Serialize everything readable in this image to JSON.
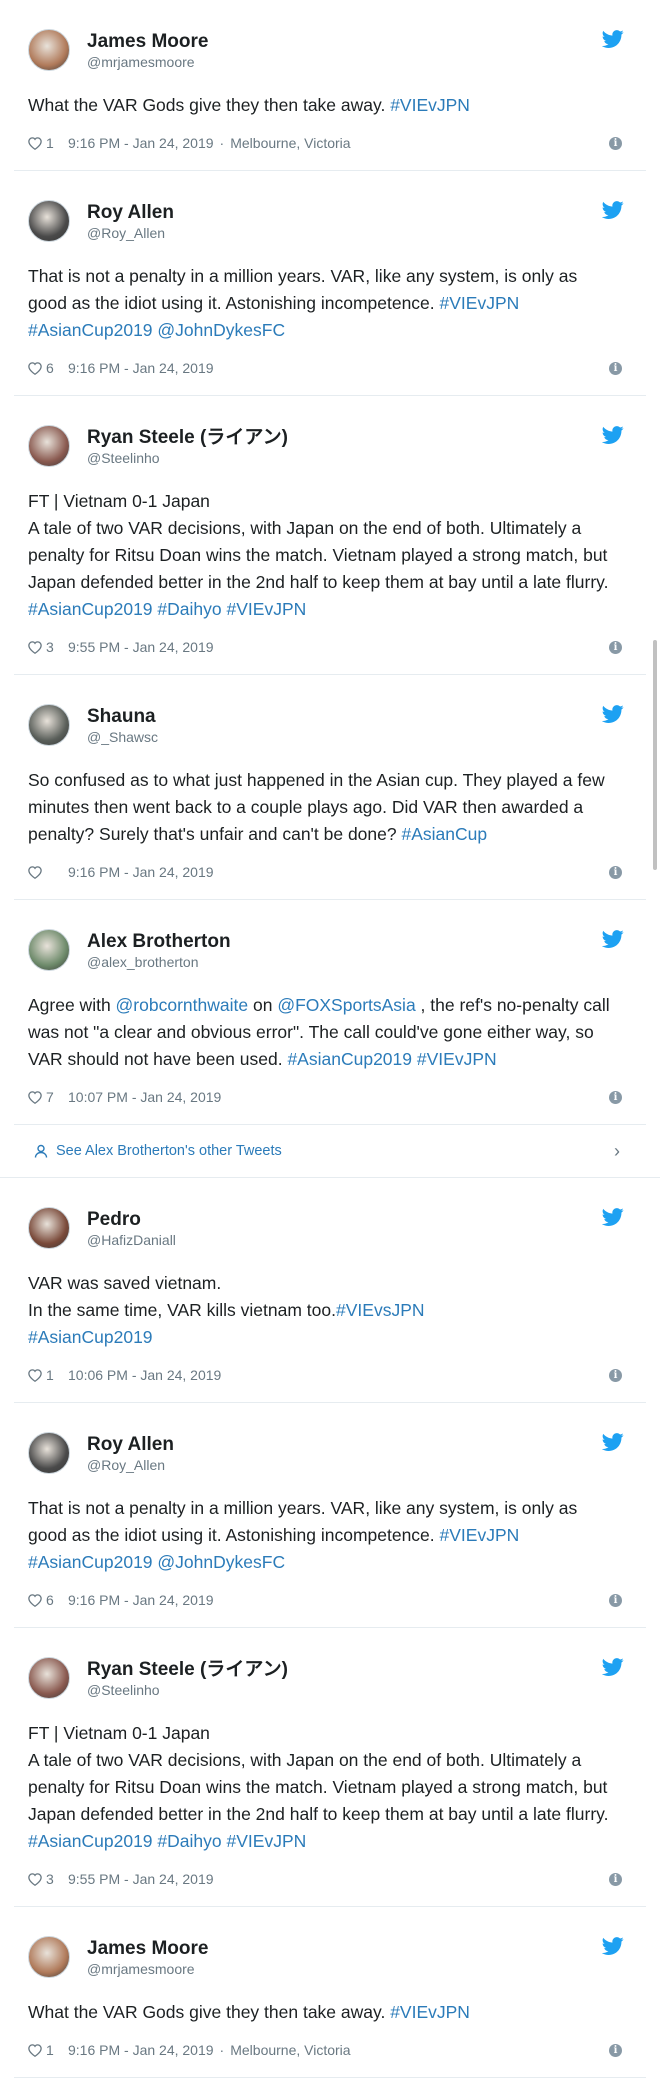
{
  "colors": {
    "link": "#2b7bb9",
    "meta": "#697882",
    "bird": "#1da1f2"
  },
  "see_more": {
    "label": "See Alex Brotherton's other Tweets"
  },
  "tweets": [
    {
      "name": "James Moore",
      "handle": "@mrjamesmoore",
      "avatar_color": "#b07a5a",
      "segments": [
        {
          "t": "What the VAR Gods give they then take away.  "
        },
        {
          "t": "#VIEvJPN",
          "link": true
        }
      ],
      "likes": "1",
      "time": "9:16 PM - Jan 24, 2019",
      "location": "Melbourne, Victoria"
    },
    {
      "name": "Roy Allen",
      "handle": "@Roy_Allen",
      "avatar_color": "#4a4a4a",
      "segments": [
        {
          "t": "That is not a penalty in a million years. VAR, like any system, is only as good as the idiot using it.  Astonishing incompetence. "
        },
        {
          "t": "#VIEvJPN",
          "link": true
        },
        {
          "t": " "
        },
        {
          "t": "#AsianCup2019",
          "link": true
        },
        {
          "t": " "
        },
        {
          "t": "@JohnDykesFC",
          "link": true
        }
      ],
      "likes": "6",
      "time": "9:16 PM - Jan 24, 2019",
      "location": ""
    },
    {
      "name": "Ryan Steele (ライアン)",
      "handle": "@Steelinho",
      "avatar_color": "#8a5a50",
      "segments": [
        {
          "t": "FT | Vietnam 0-1 Japan\nA tale of two VAR decisions, with Japan on the end of both. Ultimately a penalty for Ritsu Doan wins the match. Vietnam played a strong match, but Japan defended better in the 2nd half to keep them at bay until a late flurry. "
        },
        {
          "t": "#AsianCup2019",
          "link": true
        },
        {
          "t": " "
        },
        {
          "t": "#Daihyo",
          "link": true
        },
        {
          "t": " "
        },
        {
          "t": "#VIEvJPN",
          "link": true
        }
      ],
      "likes": "3",
      "time": "9:55 PM - Jan 24, 2019",
      "location": ""
    },
    {
      "name": "Shauna",
      "handle": "@_Shawsc",
      "avatar_color": "#5a5f5a",
      "segments": [
        {
          "t": "So confused as to what just happened in the Asian cup. They played a few minutes then went back to a couple plays ago. Did VAR then awarded a penalty? Surely that's unfair and can't be done? "
        },
        {
          "t": "#AsianCup",
          "link": true
        }
      ],
      "likes": "",
      "time": "9:16 PM - Jan 24, 2019",
      "location": ""
    },
    {
      "name": "Alex Brotherton",
      "handle": "@alex_brotherton",
      "avatar_color": "#6d8a6a",
      "segments": [
        {
          "t": "Agree with "
        },
        {
          "t": "@robcornthwaite",
          "link": true
        },
        {
          "t": " on "
        },
        {
          "t": "@FOXSportsAsia",
          "link": true
        },
        {
          "t": " , the ref's no-penalty call was not \"a clear and obvious error\". The call could've gone either way, so VAR should not have been used. "
        },
        {
          "t": "#AsianCup2019",
          "link": true
        },
        {
          "t": " "
        },
        {
          "t": "#VIEvJPN",
          "link": true
        }
      ],
      "likes": "7",
      "time": "10:07 PM - Jan 24, 2019",
      "location": ""
    },
    {
      "name": "Pedro",
      "handle": "@HafizDaniall",
      "avatar_color": "#7a4a3a",
      "segments": [
        {
          "t": "VAR was saved vietnam.\nIn the same time, VAR kills vietnam too."
        },
        {
          "t": "#VIEvsJPN",
          "link": true
        },
        {
          "t": "\n"
        },
        {
          "t": "#AsianCup2019",
          "link": true
        }
      ],
      "likes": "1",
      "time": "10:06 PM - Jan 24, 2019",
      "location": ""
    },
    {
      "name": "Roy Allen",
      "handle": "@Roy_Allen",
      "avatar_color": "#4a4a4a",
      "segments": [
        {
          "t": "That is not a penalty in a million years. VAR, like any system, is only as good as the idiot using it.  Astonishing incompetence. "
        },
        {
          "t": "#VIEvJPN",
          "link": true
        },
        {
          "t": " "
        },
        {
          "t": "#AsianCup2019",
          "link": true
        },
        {
          "t": " "
        },
        {
          "t": "@JohnDykesFC",
          "link": true
        }
      ],
      "likes": "6",
      "time": "9:16 PM - Jan 24, 2019",
      "location": ""
    },
    {
      "name": "Ryan Steele (ライアン)",
      "handle": "@Steelinho",
      "avatar_color": "#8a5a50",
      "segments": [
        {
          "t": "FT | Vietnam 0-1 Japan\nA tale of two VAR decisions, with Japan on the end of both. Ultimately a penalty for Ritsu Doan wins the match. Vietnam played a strong match, but Japan defended better in the 2nd half to keep them at bay until a late flurry. "
        },
        {
          "t": "#AsianCup2019",
          "link": true
        },
        {
          "t": " "
        },
        {
          "t": "#Daihyo",
          "link": true
        },
        {
          "t": " "
        },
        {
          "t": "#VIEvJPN",
          "link": true
        }
      ],
      "likes": "3",
      "time": "9:55 PM - Jan 24, 2019",
      "location": ""
    },
    {
      "name": "James Moore",
      "handle": "@mrjamesmoore",
      "avatar_color": "#b07a5a",
      "segments": [
        {
          "t": "What the VAR Gods give they then take away.  "
        },
        {
          "t": "#VIEvJPN",
          "link": true
        }
      ],
      "likes": "1",
      "time": "9:16 PM - Jan 24, 2019",
      "location": "Melbourne, Victoria"
    }
  ]
}
